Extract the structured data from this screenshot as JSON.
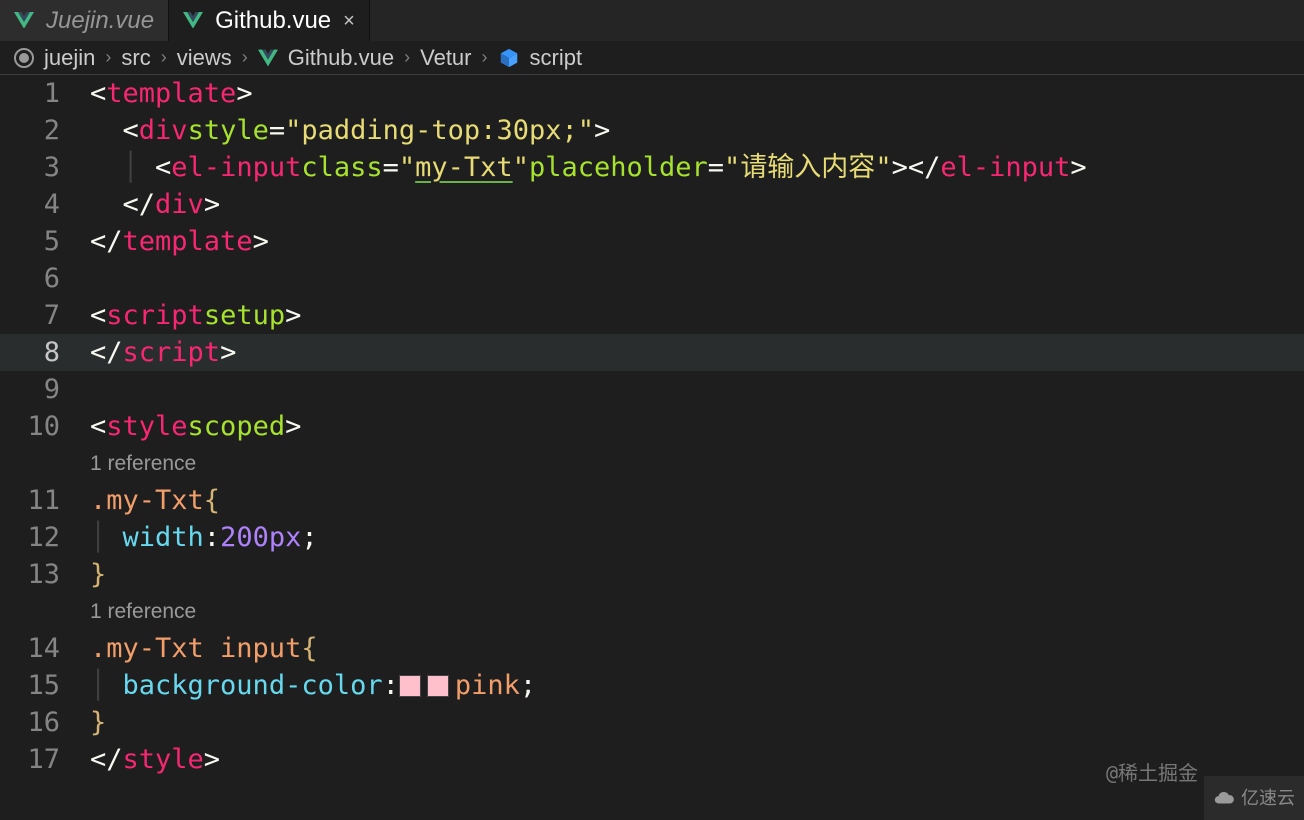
{
  "tabs": [
    {
      "label": "Juejin.vue",
      "active": false
    },
    {
      "label": "Github.vue",
      "active": true
    }
  ],
  "breadcrumbs": {
    "items": [
      "juejin",
      "src",
      "views",
      "Github.vue",
      "Vetur",
      "script"
    ]
  },
  "code": {
    "lines": [
      {
        "n": 1
      },
      {
        "n": 2,
        "style_val": "padding-top:30px;"
      },
      {
        "n": 3,
        "class_val": "my-Txt",
        "placeholder_val": "请输入内容"
      },
      {
        "n": 4
      },
      {
        "n": 5
      },
      {
        "n": 6
      },
      {
        "n": 7
      },
      {
        "n": 8
      },
      {
        "n": 9
      },
      {
        "n": 10
      },
      {
        "n": 11,
        "sel": ".my-Txt"
      },
      {
        "n": 12,
        "prop": "width",
        "val": "200px"
      },
      {
        "n": 13
      },
      {
        "n": 14,
        "sel": ".my-Txt input"
      },
      {
        "n": 15,
        "prop": "background-color",
        "val": "pink"
      },
      {
        "n": 16
      },
      {
        "n": 17
      }
    ],
    "tag_template": "template",
    "tag_div": "div",
    "tag_elinput": "el-input",
    "tag_script": "script",
    "tag_style": "style",
    "kw_setup": "setup",
    "kw_scoped": "scoped",
    "attr_style": "style",
    "attr_class": "class",
    "attr_placeholder": "placeholder",
    "codelens_text": "1 reference"
  },
  "watermarks": {
    "juejin": "@稀土掘金",
    "yisu": "亿速云"
  },
  "colors": {
    "pink_swatch": "#ffc0cb"
  }
}
